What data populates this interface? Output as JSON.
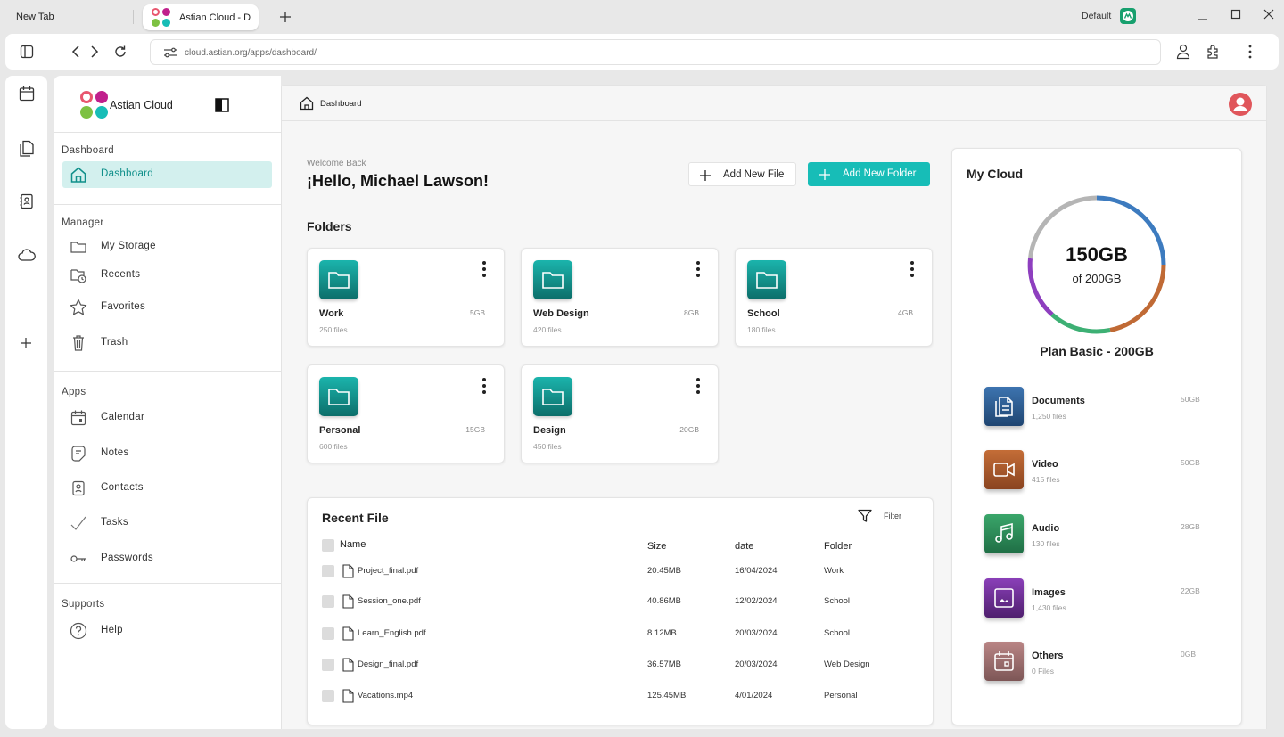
{
  "browser": {
    "tab_new": "New Tab",
    "tab_active": "Astian Cloud - D",
    "profile": "Default",
    "url": "cloud.astian.org/apps/dashboard/"
  },
  "sidebar": {
    "brand": "Astian Cloud",
    "sections": {
      "dashboard": "Dashboard",
      "manager": "Manager",
      "apps": "Apps",
      "supports": "Supports"
    },
    "items": {
      "dashboard": "Dashboard",
      "my_storage": "My Storage",
      "recents": "Recents",
      "favorites": "Favorites",
      "trash": "Trash",
      "calendar": "Calendar",
      "notes": "Notes",
      "contacts": "Contacts",
      "tasks": "Tasks",
      "passwords": "Passwords",
      "help": "Help"
    }
  },
  "main": {
    "breadcrumb": "Dashboard",
    "welcome": "Welcome Back",
    "greeting": "¡Hello, Michael Lawson!",
    "add_file": "Add New File",
    "add_folder": "Add New Folder",
    "folders_title": "Folders",
    "folders": [
      {
        "name": "Work",
        "files": "250 files",
        "size": "5GB"
      },
      {
        "name": "Web Design",
        "files": "420 files",
        "size": "8GB"
      },
      {
        "name": "School",
        "files": "180 files",
        "size": "4GB"
      },
      {
        "name": "Personal",
        "files": "600 files",
        "size": "15GB"
      },
      {
        "name": "Design",
        "files": "450 files",
        "size": "20GB"
      }
    ],
    "recent": {
      "title": "Recent File",
      "filter": "Filter",
      "headers": {
        "name": "Name",
        "size": "Size",
        "date": "date",
        "folder": "Folder"
      },
      "rows": [
        {
          "name": "Project_final.pdf",
          "size": "20.45MB",
          "date": "16/04/2024",
          "folder": "Work"
        },
        {
          "name": "Session_one.pdf",
          "size": "40.86MB",
          "date": "12/02/2024",
          "folder": "School"
        },
        {
          "name": "Learn_English.pdf",
          "size": "8.12MB",
          "date": "20/03/2024",
          "folder": "School"
        },
        {
          "name": "Design_final.pdf",
          "size": "36.57MB",
          "date": "20/03/2024",
          "folder": "Web Design"
        },
        {
          "name": "Vacations.mp4",
          "size": "125.45MB",
          "date": "4/01/2024",
          "folder": "Personal"
        }
      ]
    }
  },
  "cloud": {
    "title": "My Cloud",
    "used": "150GB",
    "total": "of 200GB",
    "plan": "Plan Basic - 200GB",
    "ring_colors": {
      "documents": "#3d7bbf",
      "video": "#c06a35",
      "audio": "#3db074",
      "images": "#8e3fbf",
      "free": "#b5b5b5"
    },
    "categories": [
      {
        "name": "Documents",
        "files": "1,250 files",
        "size": "50GB",
        "color": "#2c5a8c",
        "icon": "documents-icon"
      },
      {
        "name": "Video",
        "files": "415 files",
        "size": "50GB",
        "color": "#a4572b",
        "icon": "video-icon"
      },
      {
        "name": "Audio",
        "files": "130 files",
        "size": "28GB",
        "color": "#2e8b57",
        "icon": "music-icon"
      },
      {
        "name": "Images",
        "files": "1,430 files",
        "size": "22GB",
        "color": "#6a2c91",
        "icon": "image-icon"
      },
      {
        "name": "Others",
        "files": "0 Files",
        "size": "0GB",
        "color": "#9c6d6d",
        "icon": "calendar-box-icon"
      }
    ]
  },
  "colors": {
    "accent": "#17bdb7",
    "folder": "#0f8f8a"
  }
}
